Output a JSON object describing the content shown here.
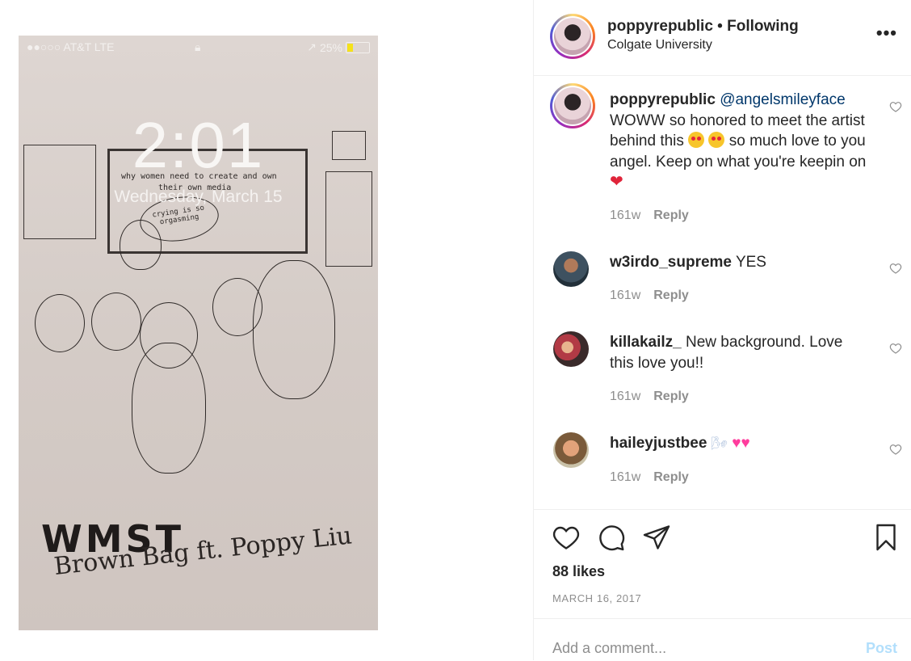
{
  "phone": {
    "carrier": "●●○○○ AT&T  LTE",
    "battery": "25%",
    "battery_level": 0.25,
    "time": "2:01",
    "date": "Wednesday, March 15",
    "board_line1": "why women need to create and own",
    "board_line2": "their own media",
    "bubble_line1": "crying is so",
    "bubble_line2": "orgasming",
    "caption_main": "WMST",
    "caption_sub": "Brown Bag ft. Poppy Liu"
  },
  "header": {
    "username": "poppyrepublic",
    "separator": " • ",
    "follow_status": "Following",
    "location": "Colgate University"
  },
  "comments": [
    {
      "username": "poppyrepublic",
      "mention": "@angelsmileyface",
      "text_a": "WOWW so honored to meet the artist behind this",
      "text_b": " so much love to you angel. Keep on what you're keepin on",
      "age": "161w",
      "reply": "Reply"
    },
    {
      "username": "w3irdo_supreme",
      "text": "YES",
      "age": "161w",
      "reply": "Reply"
    },
    {
      "username": "killakailz_",
      "text": "New background. Love this love you!!",
      "age": "161w",
      "reply": "Reply"
    },
    {
      "username": "haileyjustbee",
      "text": "",
      "age": "161w",
      "reply": "Reply"
    }
  ],
  "likes": "88 likes",
  "post_date": "MARCH 16, 2017",
  "add_comment": {
    "placeholder": "Add a comment...",
    "post_label": "Post"
  }
}
